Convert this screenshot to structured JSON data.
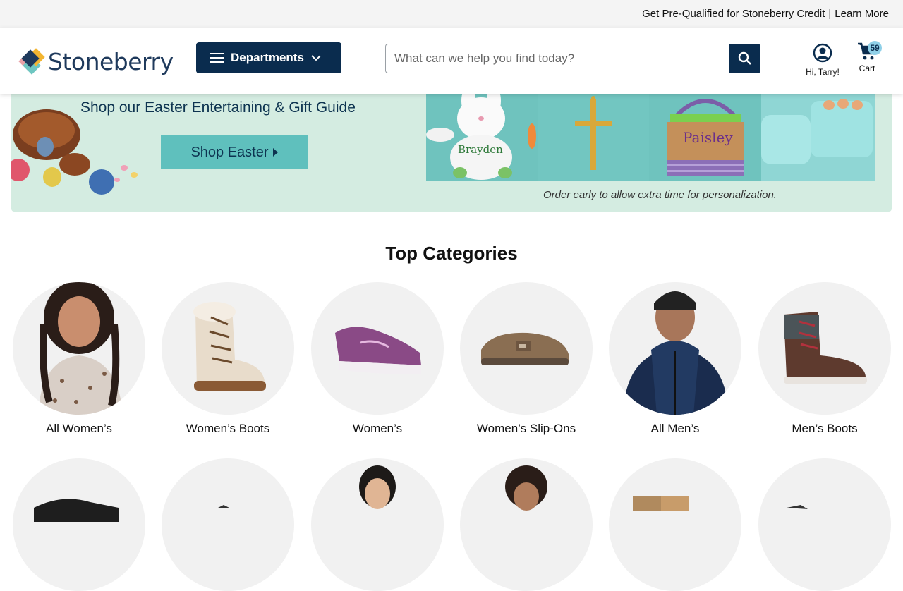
{
  "promo": {
    "text": "Get Pre-Qualified for Stoneberry Credit",
    "separator": "|",
    "link": "Learn More"
  },
  "header": {
    "logo_text": "Stoneberry",
    "departments_label": "Departments",
    "search_placeholder": "What can we help you find today?",
    "account_label": "Hi, Tarry!",
    "cart_label": "Cart",
    "cart_count": "59"
  },
  "hero": {
    "subtitle": "Shop our Easter Entertaining & Gift Guide",
    "cta": "Shop Easter",
    "bunny_name": "Brayden",
    "basket_name": "Paisley",
    "note": "Order early to allow extra time for personalization."
  },
  "top_categories": {
    "title": "Top Categories",
    "items": [
      {
        "label": "All Women’s"
      },
      {
        "label": "Women’s Boots"
      },
      {
        "label": "Women’s"
      },
      {
        "label": "Women’s Slip-Ons"
      },
      {
        "label": "All Men’s"
      },
      {
        "label": "Men’s Boots"
      }
    ]
  },
  "colors": {
    "navy": "#0a2c4e",
    "accent_teal": "#5fc0bd",
    "badge": "#8fd0e8"
  }
}
